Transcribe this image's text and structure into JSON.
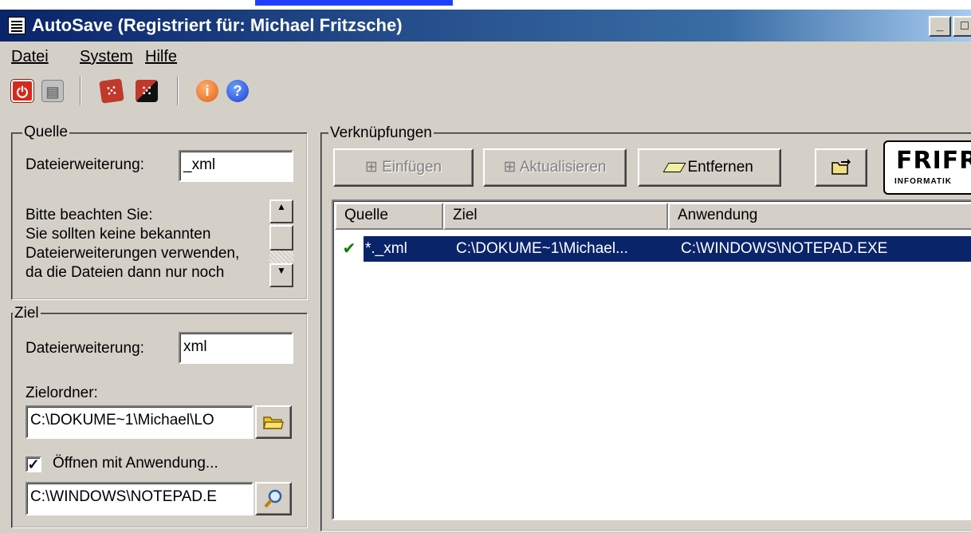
{
  "window": {
    "title": "AutoSave (Registriert für: Michael Fritzsche)",
    "controls": {
      "minimize": "_",
      "maximize": "□"
    }
  },
  "menu": {
    "items": [
      "Datei",
      "System",
      "Hilfe"
    ]
  },
  "toolbar": {
    "icons": [
      "power-icon",
      "save-icon",
      "dice-red-icon",
      "dice-red-black-icon",
      "info-icon",
      "help-icon"
    ]
  },
  "quelle": {
    "group_label": "Quelle",
    "ext_label": "Dateierweiterung:",
    "ext_value": "_xml",
    "notice": [
      "Bitte beachten Sie:",
      "Sie sollten keine bekannten",
      "Dateierweiterungen verwenden,",
      "da die Dateien dann nur noch"
    ]
  },
  "ziel": {
    "group_label": "Ziel",
    "ext_label": "Dateierweiterung:",
    "ext_value": "xml",
    "folder_label": "Zielordner:",
    "folder_value": "C:\\DOKUME~1\\Michael\\LO",
    "open_with_label": "Öffnen mit Anwendung...",
    "open_with_checked": true,
    "app_value": "C:\\WINDOWS\\NOTEPAD.E"
  },
  "links": {
    "group_label": "Verknüpfungen",
    "buttons": {
      "insert": "Einfügen",
      "update": "Aktualisieren",
      "remove": "Entfernen"
    },
    "logo": {
      "name": "FRIFR",
      "tagline": "INFORMATIK"
    },
    "columns": [
      "Quelle",
      "Ziel",
      "Anwendung"
    ],
    "rows": [
      {
        "quelle": "*._xml",
        "ziel": "C:\\DOKUME~1\\Michael...",
        "anwendung": "C:\\WINDOWS\\NOTEPAD.EXE",
        "selected": true
      }
    ]
  },
  "colors": {
    "face": "#d4d0c8",
    "title_start": "#0a246a",
    "selection": "#0a246a",
    "link_bar": "#1f3fff"
  }
}
